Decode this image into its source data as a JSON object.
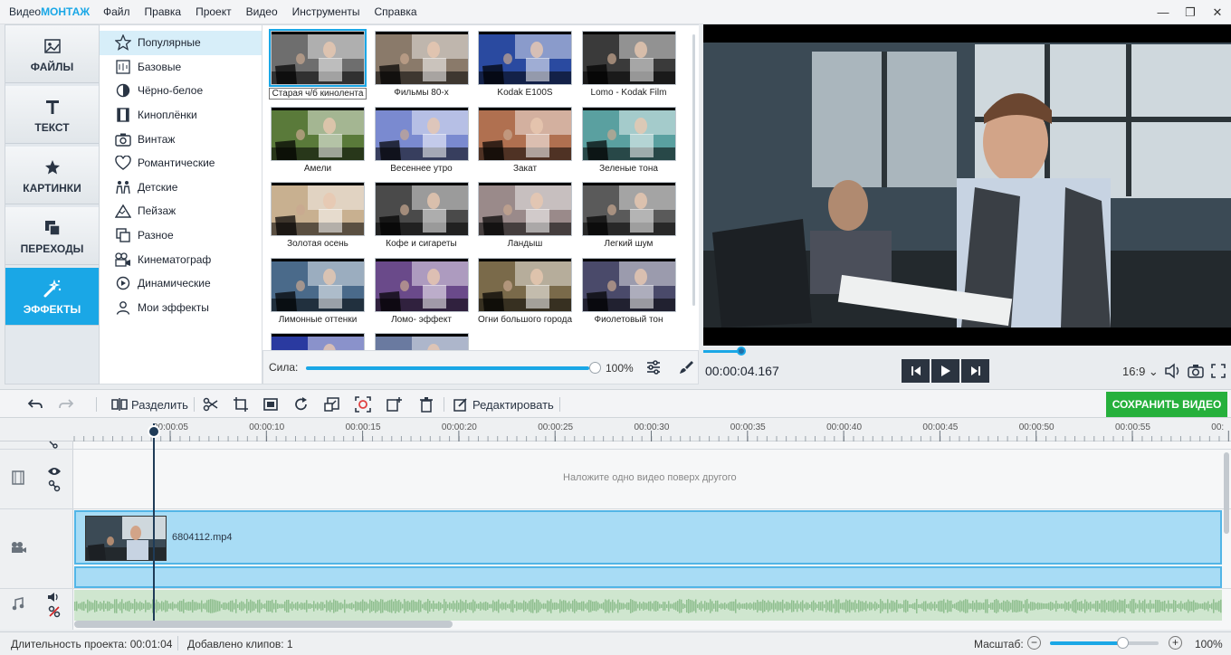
{
  "app": {
    "name_prefix": "Видео",
    "name_brand": "МОНТАЖ"
  },
  "menu": [
    "Файл",
    "Правка",
    "Проект",
    "Видео",
    "Инструменты",
    "Справка"
  ],
  "categories": [
    {
      "label": "ФАЙЛЫ",
      "icon": "image-icon"
    },
    {
      "label": "ТЕКСТ",
      "icon": "text-t-icon"
    },
    {
      "label": "КАРТИНКИ",
      "icon": "star-icon"
    },
    {
      "label": "ПЕРЕХОДЫ",
      "icon": "transition-icon"
    },
    {
      "label": "ЭФФЕКТЫ",
      "icon": "effects-wand-icon",
      "active": true
    }
  ],
  "effect_categories": [
    {
      "label": "Популярные",
      "icon": "star-outline-icon",
      "active": true
    },
    {
      "label": "Базовые",
      "icon": "basic-icon"
    },
    {
      "label": "Чёрно-белое",
      "icon": "contrast-icon"
    },
    {
      "label": "Киноплёнки",
      "icon": "film-strip-icon"
    },
    {
      "label": "Винтаж",
      "icon": "camera-icon"
    },
    {
      "label": "Романтические",
      "icon": "heart-icon"
    },
    {
      "label": "Детские",
      "icon": "kids-icon"
    },
    {
      "label": "Пейзаж",
      "icon": "mountain-icon"
    },
    {
      "label": "Разное",
      "icon": "misc-icon"
    },
    {
      "label": "Кинематограф",
      "icon": "movie-camera-icon"
    },
    {
      "label": "Динамические",
      "icon": "play-circle-icon"
    },
    {
      "label": "Мои эффекты",
      "icon": "user-icon"
    }
  ],
  "effects": [
    {
      "label": "Старая ч/б кинолента",
      "tint": "#6e6e6e",
      "selected": true
    },
    {
      "label": "Фильмы 80-х",
      "tint": "#8a7a6a"
    },
    {
      "label": "Kodak E100S",
      "tint": "#2a4aa0"
    },
    {
      "label": "Lomo - Kodak Film",
      "tint": "#3a3a3a"
    },
    {
      "label": "Амели",
      "tint": "#5a7a3a"
    },
    {
      "label": "Весеннее утро",
      "tint": "#7a8ad0"
    },
    {
      "label": "Закат",
      "tint": "#b07050"
    },
    {
      "label": "Зеленые тона",
      "tint": "#5aa0a0"
    },
    {
      "label": "Золотая осень",
      "tint": "#c8b090"
    },
    {
      "label": "Кофе и сигареты",
      "tint": "#4a4a4a"
    },
    {
      "label": "Ландыш",
      "tint": "#9a8a8a"
    },
    {
      "label": "Легкий шум",
      "tint": "#5a5a5a"
    },
    {
      "label": "Лимонные оттенки",
      "tint": "#4a6a8a"
    },
    {
      "label": "Ломо- эффект",
      "tint": "#6a4a8a"
    },
    {
      "label": "Огни большого города",
      "tint": "#7a6a4a"
    },
    {
      "label": "Фиолетовый тон",
      "tint": "#4a4a6a"
    },
    {
      "label": "",
      "tint": "#2a3aa0"
    },
    {
      "label": "",
      "tint": "#6a7aa0"
    }
  ],
  "strength": {
    "label": "Сила:",
    "value": "100%",
    "fraction": 1.0
  },
  "player": {
    "timecode": "00:00:04.167",
    "aspect": "16:9 ⌄",
    "progress_fraction": 0.07
  },
  "toolbar": {
    "split_label": "Разделить",
    "edit_label": "Редактировать",
    "save_label": "СОХРАНИТЬ ВИДЕО"
  },
  "ruler": [
    "00:00:05",
    "00:00:10",
    "00:00:15",
    "00:00:20",
    "00:00:25",
    "00:00:30",
    "00:00:35",
    "00:00:40",
    "00:00:45",
    "00:00:50",
    "00:00:55",
    "00:"
  ],
  "timeline": {
    "overlay_hint": "Наложите одно видео поверх другого",
    "clip_name": "6804112.mp4"
  },
  "status": {
    "duration": "Длительность проекта:  00:01:04",
    "clips": "Добавлено клипов: 1",
    "scale_label": "Масштаб:",
    "zoom_value": "100%",
    "zoom_minus": "−",
    "zoom_plus": "+"
  },
  "colors": {
    "accent": "#1aa7e6",
    "save": "#26b03c",
    "clip": "#a8dcf5",
    "audio": "#cfe6cf"
  }
}
